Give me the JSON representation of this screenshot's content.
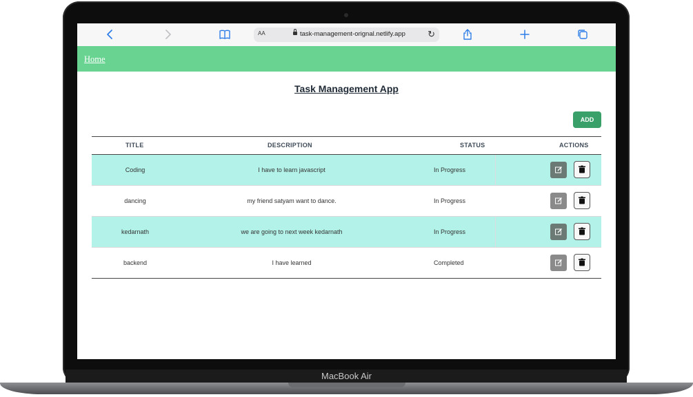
{
  "device": {
    "label": "MacBook Air"
  },
  "browser": {
    "text_size_label": "AA",
    "url": "task-management-orignal.netlify.app",
    "icons": [
      "back-icon",
      "forward-icon",
      "bookmarks-icon",
      "lock-icon",
      "reload-icon",
      "share-icon",
      "new-tab-icon",
      "tabs-icon"
    ]
  },
  "nav": {
    "home_label": "Home",
    "color": "#69d391"
  },
  "page": {
    "title": "Task Management App"
  },
  "toolbar": {
    "add_label": "ADD",
    "add_color": "#3aa06a"
  },
  "table": {
    "headers": {
      "title": "TITLE",
      "description": "DESCRIPTION",
      "status": "STATUS",
      "actions": "ACTIONS"
    },
    "highlight_color": "#b3f2e8",
    "rows": [
      {
        "title": "Coding",
        "description": "I have to learn javascript",
        "status": "In Progress"
      },
      {
        "title": "dancing",
        "description": "my friend satyam want to dance.",
        "status": "In Progress"
      },
      {
        "title": "kedarnath",
        "description": "we are going to next week kedarnath",
        "status": "In Progress"
      },
      {
        "title": "backend",
        "description": "I have learned",
        "status": "Completed"
      }
    ]
  }
}
